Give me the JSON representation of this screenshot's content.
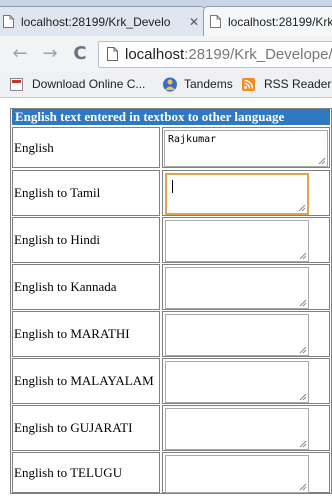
{
  "browser": {
    "tabs": [
      {
        "title": "localhost:28199/Krk_Develo",
        "active": false
      },
      {
        "title": "localhost:28199/Krk",
        "active": true
      }
    ],
    "nav": {
      "back": "←",
      "forward": "→",
      "reload": "C"
    },
    "url_host": "localhost",
    "url_rest": ":28199/Krk_Develope/",
    "bookmarks": [
      {
        "label": "Download Online C...",
        "icon": "bookmark-page-icon"
      },
      {
        "label": "Tandems",
        "icon": "tandems-icon"
      },
      {
        "label": "RSS Reader -",
        "icon": "rss-icon"
      }
    ],
    "colors": {
      "accent_orange": "#e3a34c",
      "header_blue": "#2f79c2"
    }
  },
  "form": {
    "header": "English text entered in textbox to other language",
    "rows": [
      {
        "label": "English",
        "value": "Rajkumar"
      },
      {
        "label": "English to Tamil",
        "value": ""
      },
      {
        "label": "English to Hindi",
        "value": ""
      },
      {
        "label": "English to Kannada",
        "value": ""
      },
      {
        "label": "English to MARATHI",
        "value": ""
      },
      {
        "label": "English to MALAYALAM",
        "value": ""
      },
      {
        "label": "English to GUJARATI",
        "value": ""
      },
      {
        "label": "English to TELUGU",
        "value": ""
      }
    ]
  }
}
